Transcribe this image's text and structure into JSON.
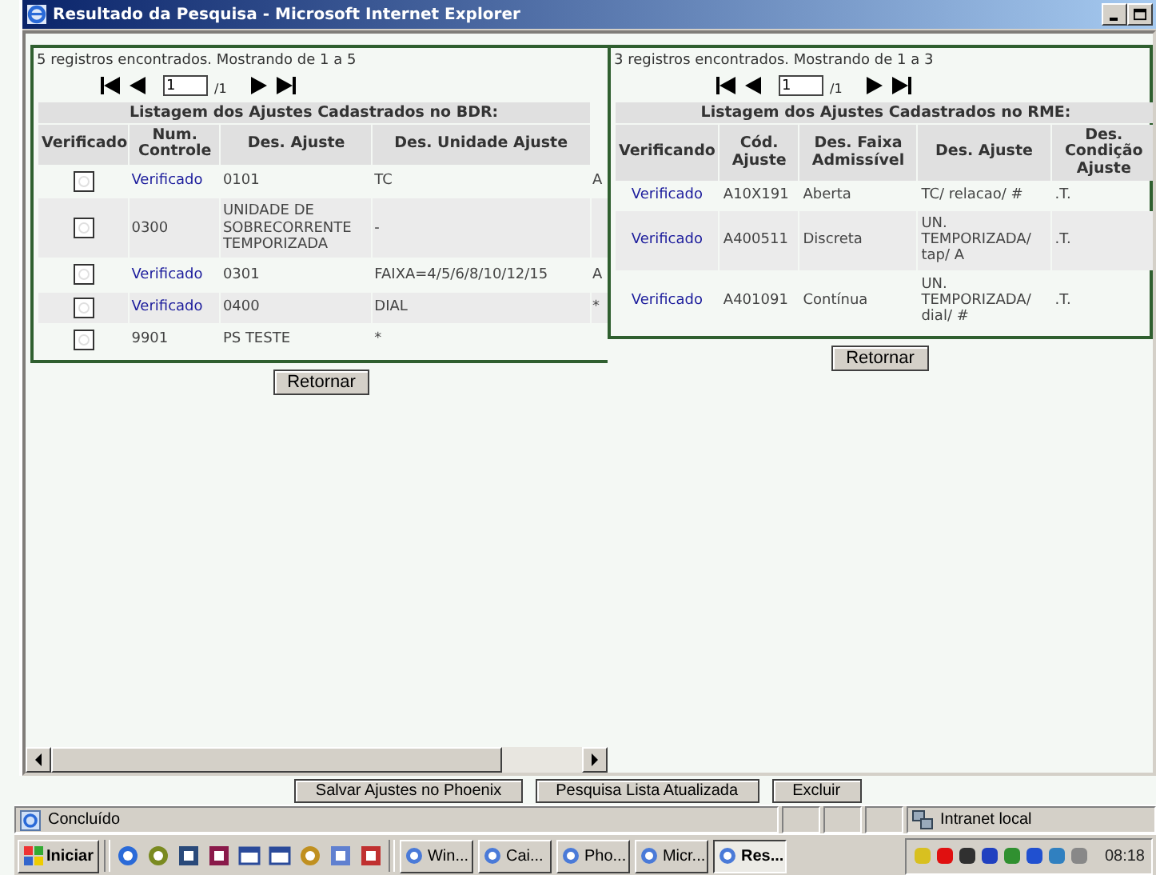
{
  "window": {
    "title": "Resultado da Pesquisa - Microsoft Internet Explorer"
  },
  "frames": [
    {
      "summary": "5 registros encontrados. Mostrando de 1 a 5",
      "pager": {
        "page": "1",
        "total": "/1"
      },
      "caption": "Listagem dos Ajustes Cadastrados no BDR:",
      "columns": [
        "Verificado",
        "Num. Controle",
        "Des. Ajuste",
        "Des. Unidade Ajuste"
      ],
      "rows": [
        {
          "cells": [
            {
              "kind": "radio",
              "checked": false
            },
            {
              "kind": "link",
              "text": "Verificado"
            },
            {
              "kind": "text",
              "text": "0101"
            },
            {
              "kind": "text",
              "text": "TC"
            },
            {
              "kind": "text",
              "text": "A"
            }
          ]
        },
        {
          "cells": [
            {
              "kind": "radio",
              "checked": false
            },
            {
              "kind": "text",
              "text": "0300"
            },
            {
              "kind": "text",
              "text": "UNIDADE DE SOBRECORRENTE TEMPORIZADA"
            },
            {
              "kind": "text",
              "text": "-"
            }
          ]
        },
        {
          "cells": [
            {
              "kind": "radio",
              "checked": false
            },
            {
              "kind": "link",
              "text": "Verificado"
            },
            {
              "kind": "text",
              "text": "0301"
            },
            {
              "kind": "text",
              "text": "FAIXA=4/5/6/8/10/12/15"
            },
            {
              "kind": "text",
              "text": "A"
            }
          ]
        },
        {
          "cells": [
            {
              "kind": "radio",
              "checked": false
            },
            {
              "kind": "link",
              "text": "Verificado"
            },
            {
              "kind": "text",
              "text": "0400"
            },
            {
              "kind": "text",
              "text": "DIAL"
            },
            {
              "kind": "text",
              "text": "*"
            }
          ]
        },
        {
          "cells": [
            {
              "kind": "radio",
              "checked": false
            },
            {
              "kind": "text",
              "text": "9901"
            },
            {
              "kind": "text",
              "text": "PS TESTE"
            },
            {
              "kind": "text",
              "text": "*"
            }
          ]
        }
      ],
      "button": "Retornar"
    },
    {
      "summary": "3 registros encontrados. Mostrando de 1 a 3",
      "pager": {
        "page": "1",
        "total": "/1"
      },
      "caption": "Listagem dos Ajustes Cadastrados no RME:",
      "columns": [
        "Verificando",
        "Cód. Ajuste",
        "Des. Faixa Admissível",
        "Des. Ajuste",
        "Des. Condição Ajuste"
      ],
      "rows": [
        {
          "cells": [
            {
              "kind": "link",
              "text": "Verificado"
            },
            {
              "kind": "text",
              "text": "A10X191"
            },
            {
              "kind": "text",
              "text": "Aberta"
            },
            {
              "kind": "text",
              "text": "TC/ relacao/ #"
            },
            {
              "kind": "text",
              "text": ".T."
            }
          ]
        },
        {
          "cells": [
            {
              "kind": "link",
              "text": "Verificado"
            },
            {
              "kind": "text",
              "text": "A400511"
            },
            {
              "kind": "text",
              "text": "Discreta"
            },
            {
              "kind": "text",
              "text": "UN. TEMPORIZADA/ tap/ A"
            },
            {
              "kind": "text",
              "text": ".T."
            }
          ]
        },
        {
          "cells": [
            {
              "kind": "link",
              "text": "Verificado"
            },
            {
              "kind": "text",
              "text": "A401091"
            },
            {
              "kind": "text",
              "text": "Contínua"
            },
            {
              "kind": "text",
              "text": "UN. TEMPORIZADA/ dial/ #"
            },
            {
              "kind": "text",
              "text": ".T."
            }
          ]
        }
      ],
      "button": "Retornar"
    }
  ],
  "page_buttons": [
    "Salvar Ajustes no Phoenix",
    "Pesquisa Lista Atualizada",
    "Excluir"
  ],
  "status_bar": {
    "text": "Concluído",
    "zone": "Intranet local"
  },
  "taskbar": {
    "start": "Iniciar",
    "tasks": [
      {
        "label": "Win...",
        "selected": false
      },
      {
        "label": "Cai...",
        "selected": false
      },
      {
        "label": "Pho...",
        "selected": false
      },
      {
        "label": "Micr...",
        "selected": false
      },
      {
        "label": "Res...",
        "selected": true
      }
    ],
    "clock": "08:18"
  }
}
